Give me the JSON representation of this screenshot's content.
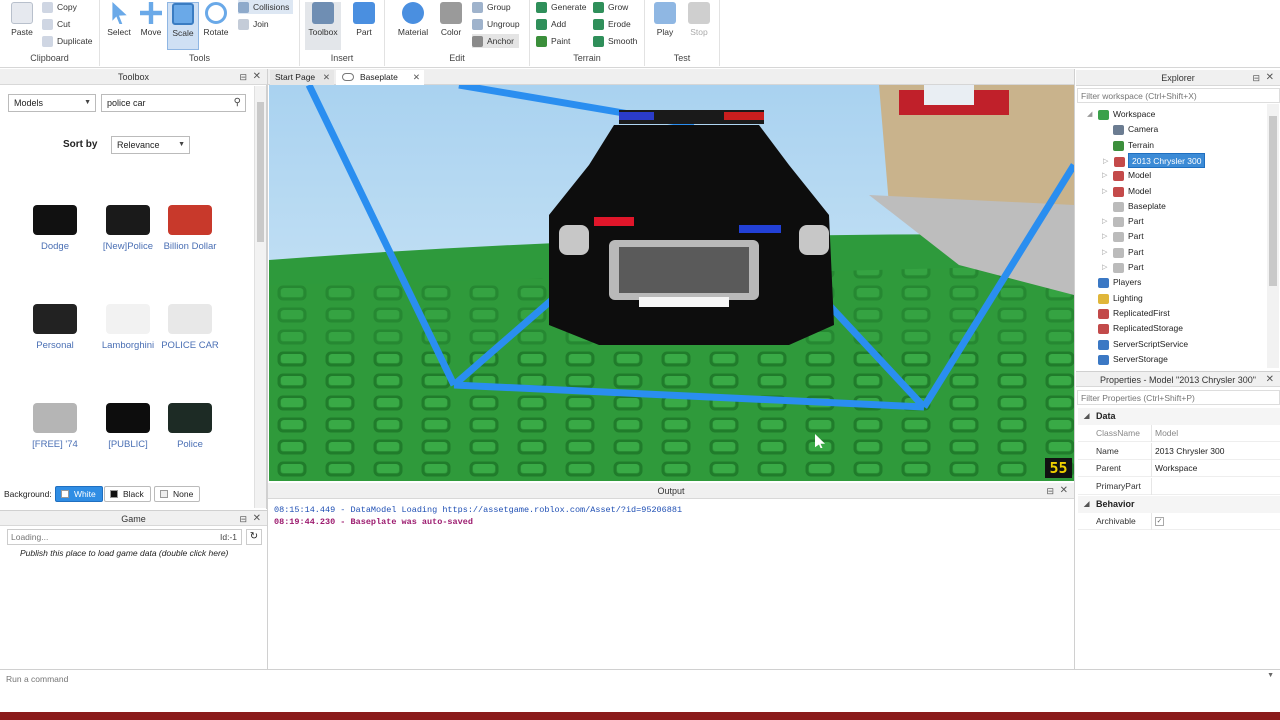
{
  "ribbon": {
    "clipboard": {
      "label": "Clipboard",
      "paste": "Paste",
      "copy": "Copy",
      "cut": "Cut",
      "duplicate": "Duplicate"
    },
    "tools": {
      "label": "Tools",
      "select": "Select",
      "move": "Move",
      "scale": "Scale",
      "rotate": "Rotate",
      "collisions": "Collisions",
      "join": "Join"
    },
    "insert": {
      "label": "Insert",
      "toolbox": "Toolbox",
      "part": "Part"
    },
    "edit": {
      "label": "Edit",
      "material": "Material",
      "color": "Color",
      "group": "Group",
      "ungroup": "Ungroup",
      "anchor": "Anchor"
    },
    "terrain": {
      "label": "Terrain",
      "generate": "Generate",
      "add": "Add",
      "paint": "Paint",
      "grow": "Grow",
      "erode": "Erode",
      "smooth": "Smooth"
    },
    "test": {
      "label": "Test",
      "play": "Play",
      "stop": "Stop"
    }
  },
  "toolbox": {
    "title": "Toolbox",
    "category": "Models",
    "search_value": "police car",
    "sort_label": "Sort by",
    "sort_value": "Relevance",
    "models": [
      {
        "name": "Dodge",
        "color": "#111111"
      },
      {
        "name": "[New]Police",
        "color": "#1a1a1a"
      },
      {
        "name": "Billion Dollar",
        "color": "#c8392b"
      },
      {
        "name": "Personal",
        "color": "#222222"
      },
      {
        "name": "Lamborghini",
        "color": "#f2f2f2"
      },
      {
        "name": "POLICE CAR",
        "color": "#e8e8e8"
      },
      {
        "name": "[FREE] '74",
        "color": "#b5b5b5"
      },
      {
        "name": "[PUBLIC]",
        "color": "#0d0d0d"
      },
      {
        "name": "Police",
        "color": "#1d2b25"
      }
    ],
    "background_label": "Background:",
    "bg_white": "White",
    "bg_black": "Black",
    "bg_none": "None"
  },
  "game": {
    "title": "Game",
    "search_placeholder": "Loading...",
    "id_label": "Id:-1",
    "hint": "Publish this place to load game data (double click here)"
  },
  "tabs": [
    {
      "label": "Start Page"
    },
    {
      "label": "Baseplate"
    }
  ],
  "viewport": {
    "badge": "55"
  },
  "output": {
    "title": "Output",
    "lines": [
      {
        "text": "08:15:14.449 - DataModel Loading https://assetgame.roblox.com/Asset/?id=95206881",
        "color": "#1f4fb4"
      },
      {
        "text": "08:19:44.230 - Baseplate was auto-saved",
        "color": "#9c1a6e"
      }
    ]
  },
  "explorer": {
    "title": "Explorer",
    "filter_placeholder": "Filter workspace (Ctrl+Shift+X)",
    "items": [
      {
        "label": "Workspace",
        "color": "#3aa14a"
      },
      {
        "label": "Camera",
        "color": "#6b7c91"
      },
      {
        "label": "Terrain",
        "color": "#3c8f3c"
      },
      {
        "label": "2013 Chrysler 300",
        "color": "#c44a4a"
      },
      {
        "label": "Model",
        "color": "#c44a4a"
      },
      {
        "label": "Model",
        "color": "#c44a4a"
      },
      {
        "label": "Baseplate",
        "color": "#bbbbbb"
      },
      {
        "label": "Part",
        "color": "#bbbbbb"
      },
      {
        "label": "Part",
        "color": "#bbbbbb"
      },
      {
        "label": "Part",
        "color": "#bbbbbb"
      },
      {
        "label": "Part",
        "color": "#bbbbbb"
      },
      {
        "label": "Players",
        "color": "#3b78c4"
      },
      {
        "label": "Lighting",
        "color": "#e0b63a"
      },
      {
        "label": "ReplicatedFirst",
        "color": "#c24a4a"
      },
      {
        "label": "ReplicatedStorage",
        "color": "#c24a4a"
      },
      {
        "label": "ServerScriptService",
        "color": "#3b78c4"
      },
      {
        "label": "ServerStorage",
        "color": "#3b78c4"
      }
    ]
  },
  "properties": {
    "title": "Properties - Model \"2013 Chrysler 300\"",
    "filter_placeholder": "Filter Properties (Ctrl+Shift+P)",
    "cat_data": "Data",
    "cat_behavior": "Behavior",
    "rows": [
      {
        "key": "ClassName",
        "value": "Model"
      },
      {
        "key": "Name",
        "value": "2013 Chrysler 300"
      },
      {
        "key": "Parent",
        "value": "Workspace"
      },
      {
        "key": "PrimaryPart",
        "value": ""
      }
    ],
    "archivable_key": "Archivable"
  },
  "command": {
    "placeholder": "Run a command"
  }
}
